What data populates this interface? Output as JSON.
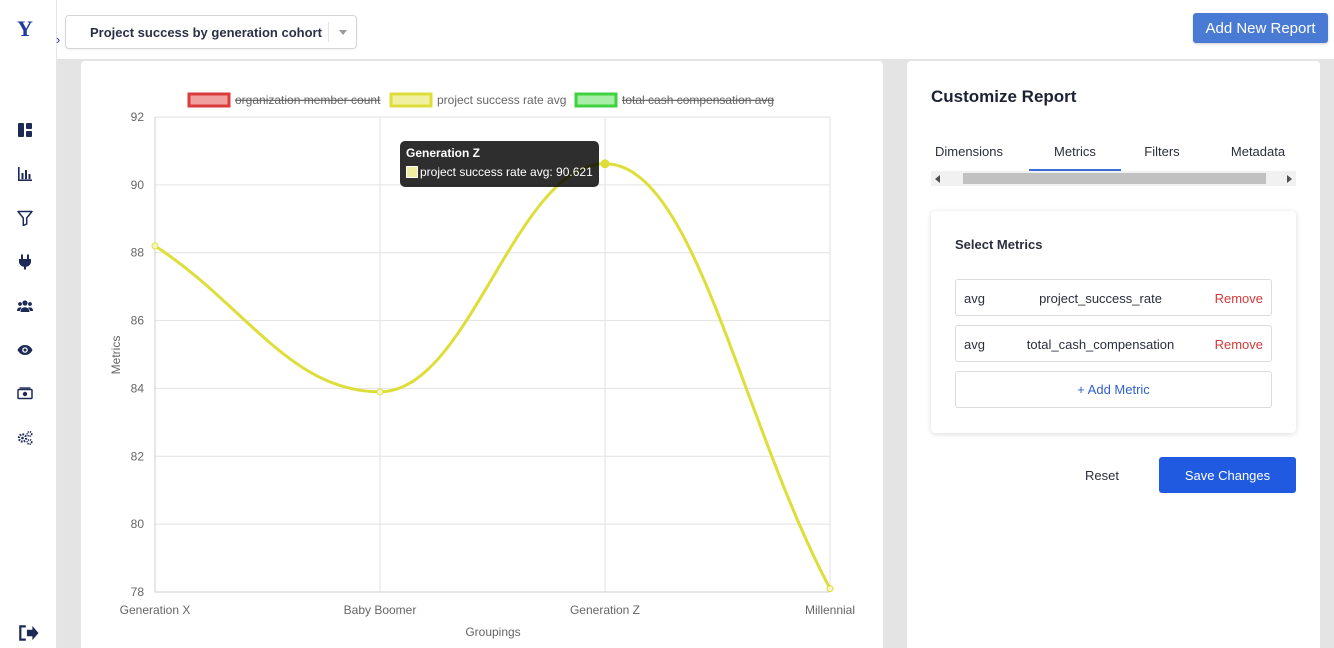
{
  "app": {
    "logo_letter": "Y"
  },
  "header": {
    "report_name": "Project success by generation cohort",
    "add_report_label": "Add New Report"
  },
  "sidebar": {
    "items": [
      {
        "icon": "dashboard-icon"
      },
      {
        "icon": "bar-chart-icon"
      },
      {
        "icon": "filter-icon"
      },
      {
        "icon": "plug-icon"
      },
      {
        "icon": "users-icon"
      },
      {
        "icon": "eye-icon"
      },
      {
        "icon": "money-icon"
      },
      {
        "icon": "gears-icon"
      }
    ],
    "logout_icon": "logout-icon"
  },
  "chart_data": {
    "type": "line",
    "categories": [
      "Generation X",
      "Baby Boomer",
      "Generation Z",
      "Millennial"
    ],
    "xlabel": "Groupings",
    "ylabel": "Metrics",
    "ylim": [
      78,
      92
    ],
    "yticks": [
      78,
      80,
      82,
      84,
      86,
      88,
      90,
      92
    ],
    "grid": true,
    "legend_position": "top",
    "legend": [
      {
        "name": "organization member count",
        "color": "#d93b3b",
        "fill": "#f1a0a0",
        "hidden": true
      },
      {
        "name": "project success rate avg",
        "color": "#dede3a",
        "fill": "#f0f0a0",
        "hidden": false
      },
      {
        "name": "total cash compensation avg",
        "color": "#3fd23f",
        "fill": "#a8eda8",
        "hidden": true
      }
    ],
    "series": [
      {
        "name": "project success rate avg",
        "values": [
          88.2,
          83.9,
          90.621,
          78.1
        ],
        "color": "#dede3a"
      }
    ],
    "tooltip": {
      "title": "Generation Z",
      "label": "project success rate avg: 90.621"
    }
  },
  "panel": {
    "title": "Customize Report",
    "tabs": [
      "Dimensions",
      "Metrics",
      "Filters",
      "Metadata"
    ],
    "active_tab": "Metrics",
    "metrics_section_title": "Select Metrics",
    "metrics": [
      {
        "agg": "avg",
        "field": "project_success_rate",
        "remove_label": "Remove"
      },
      {
        "agg": "avg",
        "field": "total_cash_compensation",
        "remove_label": "Remove"
      }
    ],
    "add_metric_label": "+ Add Metric",
    "reset_label": "Reset",
    "save_label": "Save Changes"
  }
}
